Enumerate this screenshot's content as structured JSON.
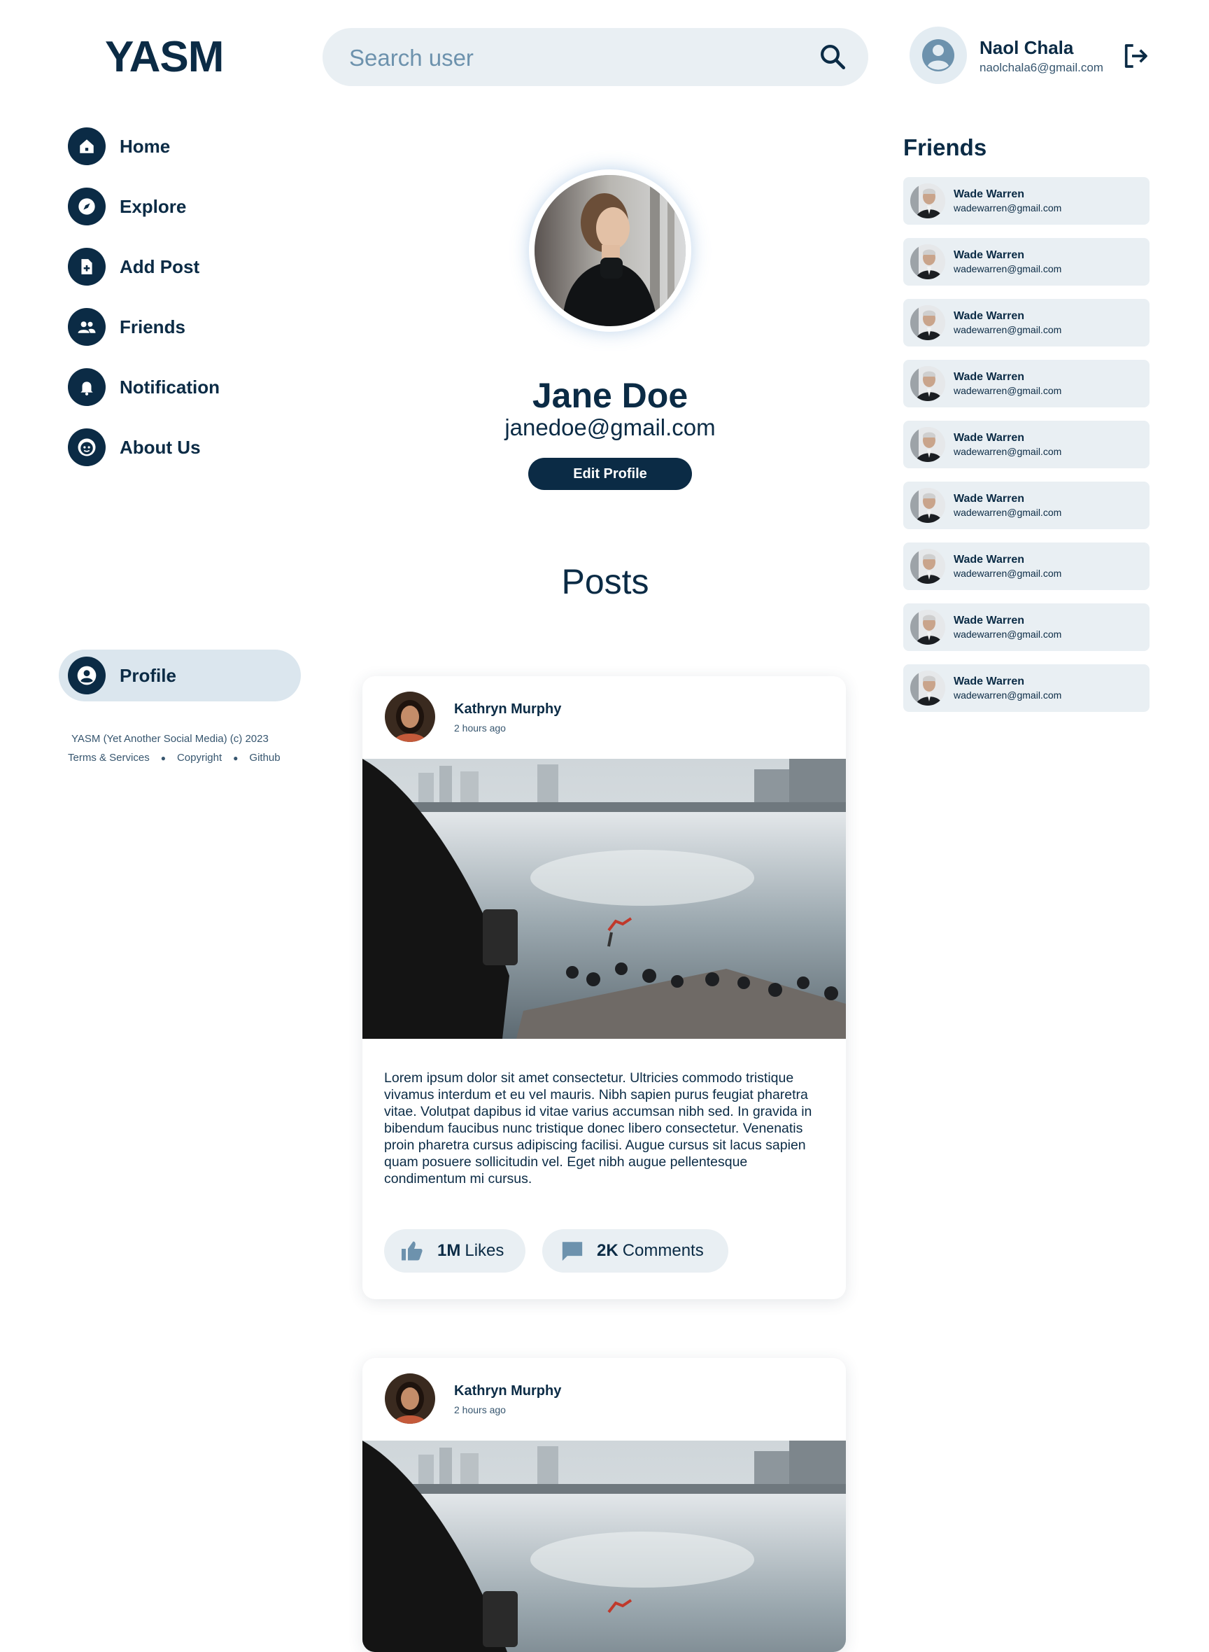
{
  "header": {
    "logo": "YASM",
    "search_placeholder": "Search user",
    "user": {
      "name": "Naol Chala",
      "email": "naolchala6@gmail.com"
    }
  },
  "nav": {
    "items": [
      {
        "label": "Home",
        "icon": "home-icon"
      },
      {
        "label": "Explore",
        "icon": "compass-icon"
      },
      {
        "label": "Add Post",
        "icon": "add-file-icon"
      },
      {
        "label": "Friends",
        "icon": "people-icon"
      },
      {
        "label": "Notification",
        "icon": "bell-icon"
      },
      {
        "label": "About Us",
        "icon": "smiley-icon"
      }
    ],
    "profile": {
      "label": "Profile",
      "icon": "user-circle-icon"
    }
  },
  "footer": {
    "copyright": "YASM (Yet Another Social Media) (c) 2023",
    "links": [
      "Terms & Services",
      "Copyright",
      "Github"
    ]
  },
  "profile": {
    "name": "Jane Doe",
    "email": "janedoe@gmail.com",
    "edit_label": "Edit Profile"
  },
  "posts_heading": "Posts",
  "posts": [
    {
      "author": "Kathryn Murphy",
      "time": "2 hours ago",
      "text": "Lorem ipsum dolor sit amet consectetur. Ultricies commodo tristique vivamus interdum et eu vel mauris. Nibh sapien purus feugiat pharetra vitae. Volutpat dapibus id vitae varius accumsan nibh sed. In gravida in bibendum faucibus nunc tristique donec libero consectetur. Venenatis proin pharetra cursus adipiscing facilisi. Augue cursus sit lacus sapien quam posuere sollicitudin vel. Eget nibh augue pellentesque condimentum mi cursus.",
      "likes_count": "1M",
      "likes_label": "Likes",
      "comments_count": "2K",
      "comments_label": "Comments"
    },
    {
      "author": "Kathryn Murphy",
      "time": "2 hours ago"
    }
  ],
  "friends": {
    "title": "Friends",
    "items": [
      {
        "name": "Wade Warren",
        "email": "wadewarren@gmail.com"
      },
      {
        "name": "Wade Warren",
        "email": "wadewarren@gmail.com"
      },
      {
        "name": "Wade Warren",
        "email": "wadewarren@gmail.com"
      },
      {
        "name": "Wade Warren",
        "email": "wadewarren@gmail.com"
      },
      {
        "name": "Wade Warren",
        "email": "wadewarren@gmail.com"
      },
      {
        "name": "Wade Warren",
        "email": "wadewarren@gmail.com"
      },
      {
        "name": "Wade Warren",
        "email": "wadewarren@gmail.com"
      },
      {
        "name": "Wade Warren",
        "email": "wadewarren@gmail.com"
      },
      {
        "name": "Wade Warren",
        "email": "wadewarren@gmail.com"
      }
    ]
  },
  "colors": {
    "primary": "#0b2b45",
    "surface": "#e9eff3",
    "active": "#dbe6ee"
  }
}
